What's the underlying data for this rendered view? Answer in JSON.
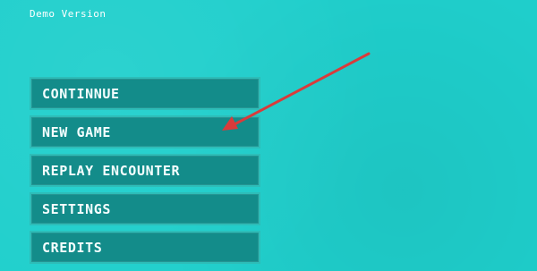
{
  "version_label": "Demo Version",
  "menu": {
    "items": [
      {
        "label": "CONTINNUE"
      },
      {
        "label": "NEW GAME"
      },
      {
        "label": "REPLAY ENCOUNTER"
      },
      {
        "label": "SETTINGS"
      },
      {
        "label": "CREDITS"
      }
    ]
  },
  "annotation": {
    "icon": "red-arrow-icon",
    "color": "#d93b3b"
  },
  "colors": {
    "background": "#1fcfcc",
    "button_fill": "#138c8a",
    "button_border": "#2dbdb8",
    "button_text": "#f4ffff"
  }
}
